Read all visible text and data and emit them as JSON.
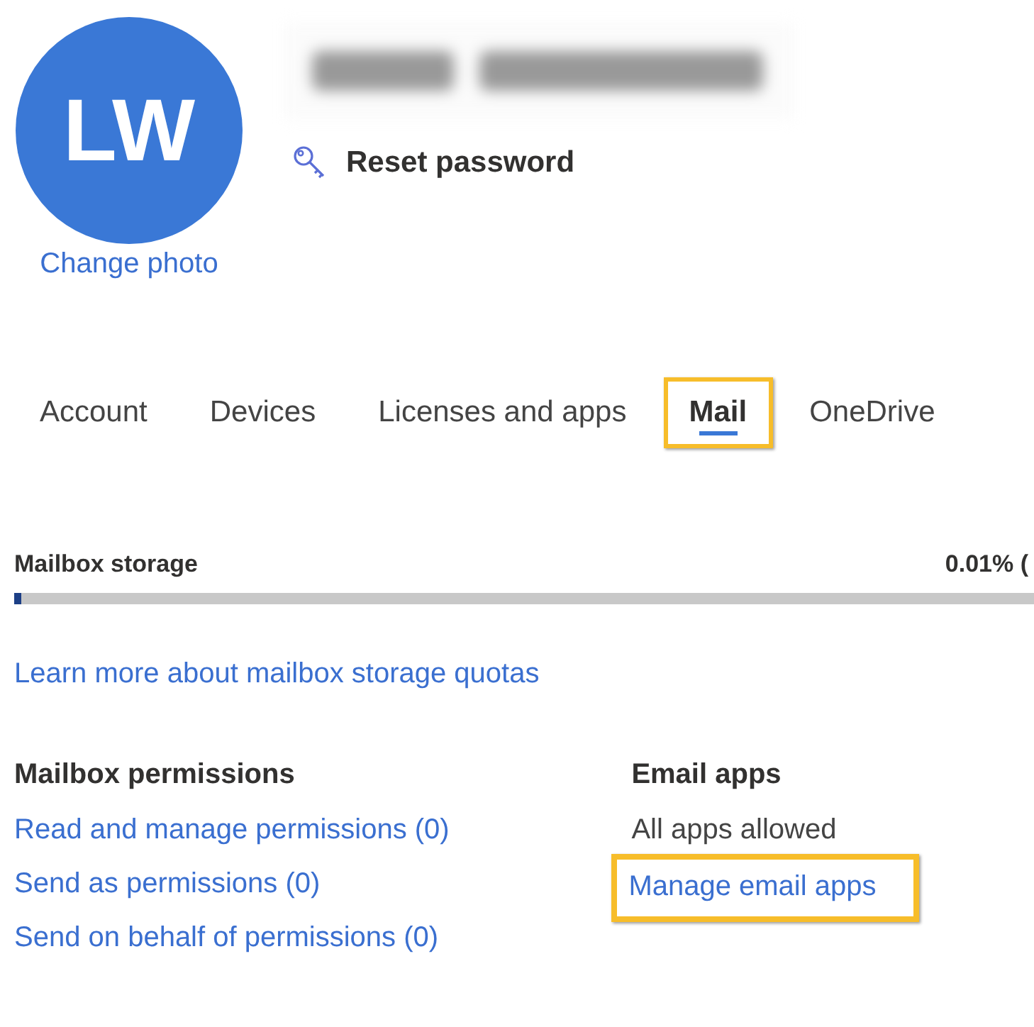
{
  "profile": {
    "initials": "LW",
    "change_photo": "Change photo",
    "reset_password": "Reset password"
  },
  "tabs": [
    {
      "label": "Account",
      "selected": false,
      "highlighted": false
    },
    {
      "label": "Devices",
      "selected": false,
      "highlighted": false
    },
    {
      "label": "Licenses and apps",
      "selected": false,
      "highlighted": false
    },
    {
      "label": "Mail",
      "selected": true,
      "highlighted": true
    },
    {
      "label": "OneDrive",
      "selected": false,
      "highlighted": false
    }
  ],
  "storage": {
    "label": "Mailbox storage",
    "reading": "0.01% (",
    "level": 0.003,
    "link": "Learn more about mailbox storage quotas"
  },
  "permissions": {
    "title": "Mailbox permissions",
    "links": [
      {
        "label": "Read and manage permissions (0)",
        "highlighted": false
      },
      {
        "label": "Send as permissions (0)",
        "highlighted": false
      },
      {
        "label": "Send on behalf of permissions (0)",
        "highlighted": false
      }
    ]
  },
  "email_apps": {
    "title": "Email apps",
    "status": "All apps allowed",
    "links": [
      {
        "label": "Manage email apps",
        "highlighted": true
      }
    ]
  }
}
